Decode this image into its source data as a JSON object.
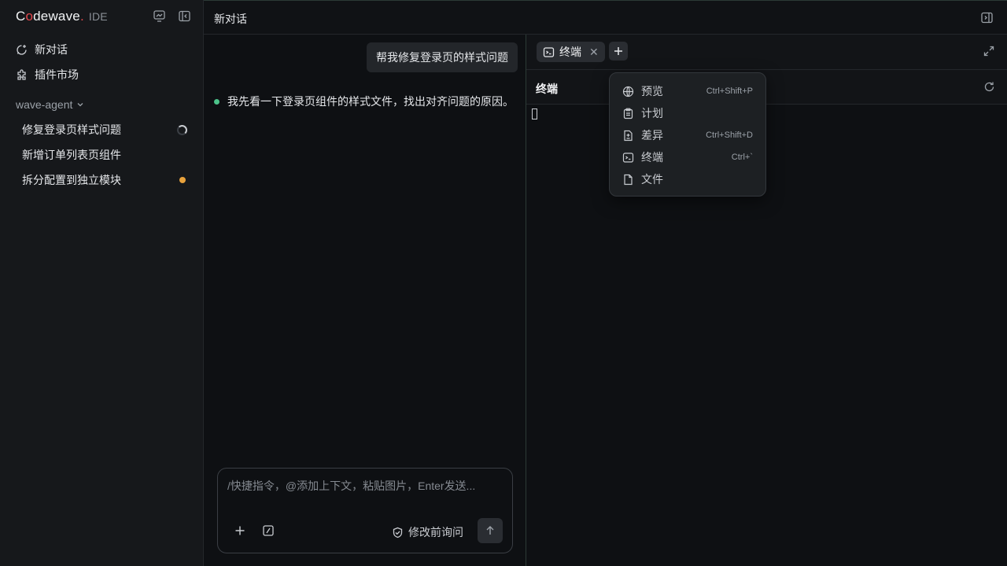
{
  "app": {
    "logo_text_1": "C",
    "logo_text_o": "o",
    "logo_text_2": "dewave",
    "logo_dot": ".",
    "ide_label": "IDE"
  },
  "sidebar": {
    "nav": [
      {
        "label": "新对话",
        "icon": "chat-plus-icon"
      },
      {
        "label": "插件市场",
        "icon": "puzzle-icon"
      }
    ],
    "workspace": "wave-agent",
    "sessions": [
      {
        "label": "修复登录页样式问题",
        "status": "running"
      },
      {
        "label": "新增订单列表页组件",
        "status": "none"
      },
      {
        "label": "拆分配置到独立模块",
        "status": "unread"
      }
    ]
  },
  "header": {
    "title": "新对话"
  },
  "chat": {
    "user_message": "帮我修复登录页的样式问题",
    "assistant_message": "我先看一下登录页组件的样式文件，找出对齐问题的原因。",
    "composer": {
      "placeholder": "/快捷指令，@添加上下文，粘贴图片，Enter发送...",
      "value": "",
      "ask_label": "修改前询问"
    }
  },
  "panel": {
    "tabs": [
      {
        "label": "终端",
        "icon": "terminal-icon"
      }
    ],
    "terminal_title": "终端"
  },
  "menu": {
    "items": [
      {
        "label": "预览",
        "shortcut": "Ctrl+Shift+P",
        "icon": "globe-icon"
      },
      {
        "label": "计划",
        "shortcut": "",
        "icon": "clipboard-icon"
      },
      {
        "label": "差异",
        "shortcut": "Ctrl+Shift+D",
        "icon": "diff-icon"
      },
      {
        "label": "终端",
        "shortcut": "Ctrl+`",
        "icon": "terminal-icon"
      },
      {
        "label": "文件",
        "shortcut": "",
        "icon": "file-icon"
      }
    ]
  },
  "colors": {
    "accent_red": "#e5484d",
    "running_green": "#4cc38a",
    "unread_orange": "#e8a23c"
  }
}
